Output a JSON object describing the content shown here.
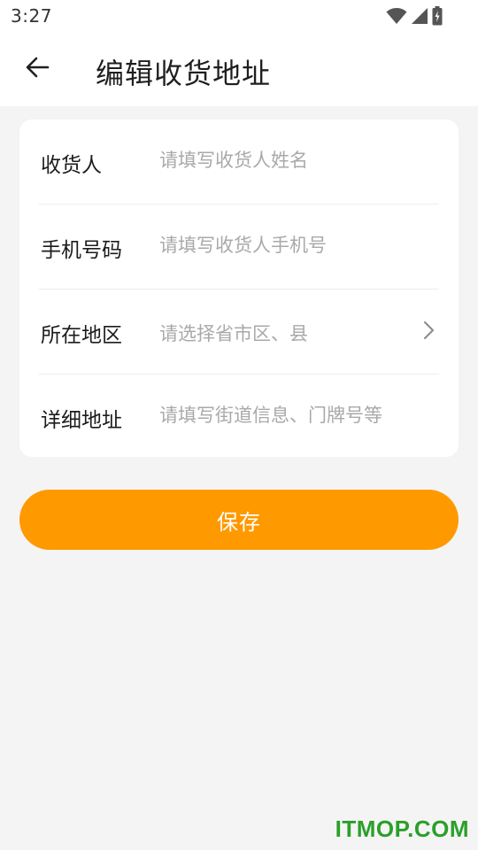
{
  "status_bar": {
    "time": "3:27",
    "icons": [
      "wifi-icon",
      "cell-signal-icon",
      "battery-icon"
    ]
  },
  "header": {
    "title": "编辑收货地址",
    "back_icon": "back-arrow-icon"
  },
  "form": {
    "rows": [
      {
        "label": "收货人",
        "placeholder": "请填写收货人姓名",
        "type": "text"
      },
      {
        "label": "手机号码",
        "placeholder": "请填写收货人手机号",
        "type": "tel"
      },
      {
        "label": "所在地区",
        "placeholder": "请选择省市区、县",
        "type": "select",
        "icon": "chevron-right-icon"
      },
      {
        "label": "详细地址",
        "placeholder": "请填写街道信息、门牌号等",
        "type": "text"
      }
    ]
  },
  "save_button": {
    "label": "保存"
  },
  "watermark": {
    "text": "ITMOP.COM"
  },
  "colors": {
    "accent": "#ff9900",
    "background": "#f5f4f5",
    "card": "#ffffff",
    "placeholder": "#a9a9a9",
    "watermark": "#2aa02a"
  }
}
